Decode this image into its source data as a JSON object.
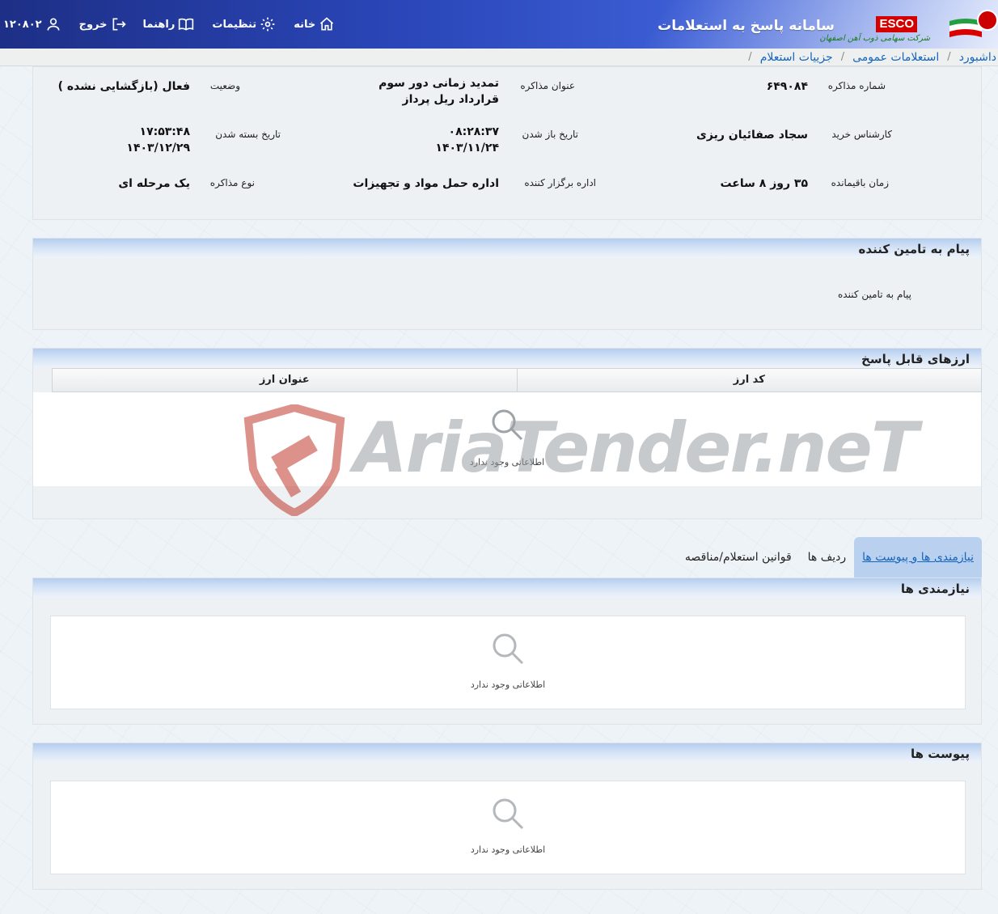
{
  "header": {
    "app_title": "سامانه پاسخ به استعلامات",
    "brand_code": "ESCO",
    "brand_name": "شرکت سهامی ذوب آهن اصفهان",
    "user_id": "۱۲۰۸۰۲",
    "logout_label": "خروج",
    "guide_label": "راهنما",
    "settings_label": "تنظیمات",
    "home_label": "خانه"
  },
  "breadcrumb": {
    "items": [
      "داشبورد",
      "استعلامات عمومی",
      "جزییات استعلام"
    ]
  },
  "info": {
    "negotiation_number_label": "شماره مذاکره",
    "negotiation_number": "۶۴۹۰۸۴",
    "title_label": "عنوان مذاکره",
    "title_line1": "تمدید زمانی دور سوم",
    "title_line2": "قرارداد ریل پرداز",
    "status_label": "وضعیت",
    "status": "فعال (بازگشایی نشده )",
    "buyer_label": "کارشناس خرید",
    "buyer": "سجاد صفائیان ریزی",
    "open_date_label": "تاریخ باز شدن",
    "open_time": "۰۸:۲۸:۳۷",
    "open_date": "۱۴۰۳/۱۱/۲۴",
    "close_date_label": "تاریخ بسته شدن",
    "close_time": "۱۷:۵۳:۴۸",
    "close_date": "۱۴۰۳/۱۲/۲۹",
    "remaining_label": "زمان باقیمانده",
    "remaining": "۳۵ روز ۸ ساعت",
    "organizer_label": "اداره برگزار کننده",
    "organizer": "اداره حمل مواد و تجهیزات",
    "type_label": "نوع مذاکره",
    "type": "یک مرحله ای"
  },
  "message": {
    "heading": "پیام به تامین کننده",
    "field_label": "پیام به تامین کننده"
  },
  "currencies": {
    "heading": "ارزهای قابل پاسخ",
    "columns": [
      "کد ارز",
      "عنوان ارز"
    ],
    "empty_text": "اطلاعاتی وجود ندارد"
  },
  "watermark": {
    "text": "AriaTender.neT"
  },
  "tabs": {
    "items": [
      "نیازمندی ها و پیوست ها",
      "ردیف ها",
      "قوانین استعلام/مناقصه"
    ],
    "active_index": 0
  },
  "needs": {
    "heading": "نیازمندی ها",
    "empty_text": "اطلاعاتی وجود ندارد"
  },
  "attachments": {
    "heading": "پیوست ها",
    "empty_text": "اطلاعاتی وجود ندارد"
  },
  "colors": {
    "header_blue": "#2a46b8",
    "link_blue": "#1565c0",
    "panel_header": "#b4cdef",
    "brand_red": "#d40000",
    "watermark_red": "#c0392b"
  }
}
